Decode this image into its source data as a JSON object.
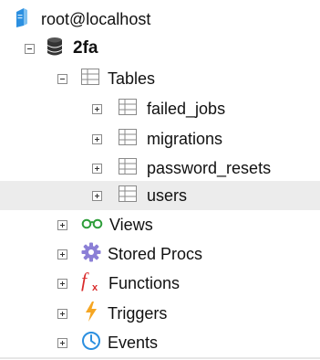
{
  "tree": {
    "server": {
      "label": "root@localhost",
      "icon": "server-icon"
    },
    "database": {
      "label": "2fa",
      "icon": "database-icon"
    },
    "tables_folder": {
      "label": "Tables",
      "icon": "table-folder-icon"
    },
    "tables": [
      {
        "label": "failed_jobs",
        "icon": "table-icon"
      },
      {
        "label": "migrations",
        "icon": "table-icon"
      },
      {
        "label": "password_resets",
        "icon": "table-icon"
      },
      {
        "label": "users",
        "icon": "table-icon",
        "selected": true
      }
    ],
    "folders": [
      {
        "label": "Views",
        "icon": "view-glasses-icon",
        "color": "#2e9e3a"
      },
      {
        "label": "Stored Procs",
        "icon": "gear-icon",
        "color": "#8b7fd6"
      },
      {
        "label": "Functions",
        "icon": "function-icon",
        "color": "#d92b2b"
      },
      {
        "label": "Triggers",
        "icon": "lightning-icon",
        "color": "#f5a623"
      },
      {
        "label": "Events",
        "icon": "clock-icon",
        "color": "#2b8fe0"
      }
    ]
  },
  "colors": {
    "selection": "#ececec",
    "server_blue": "#2b8fe0",
    "grid_gray": "#8a8a8a"
  }
}
